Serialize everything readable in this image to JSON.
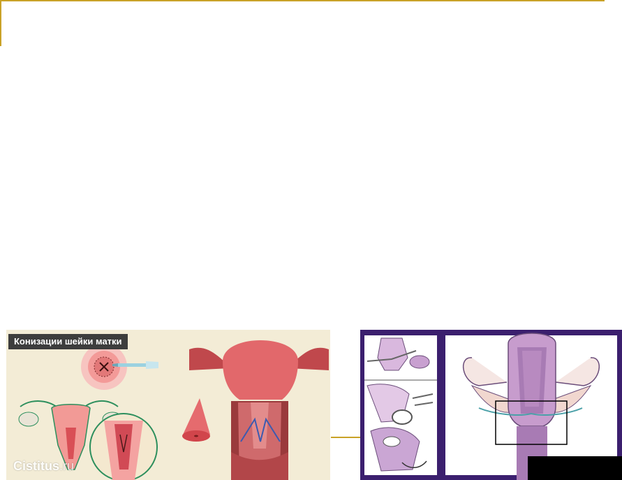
{
  "left_illustration": {
    "caption": "Конизации шейки матки",
    "watermark_main": "Cistitus",
    "watermark_suffix": ".ru"
  },
  "colors": {
    "frame_gold": "#c9a227",
    "right_panel_border": "#3b1f6e",
    "caption_bg": "#3d3d3d",
    "left_bg": "#f3ecd6",
    "tissue_pink": "#e05a5a",
    "uterus_purple": "#b88ac0"
  },
  "icons": {
    "uterus": "uterus-icon",
    "probe": "probe-icon",
    "cone": "cone-specimen-icon"
  }
}
